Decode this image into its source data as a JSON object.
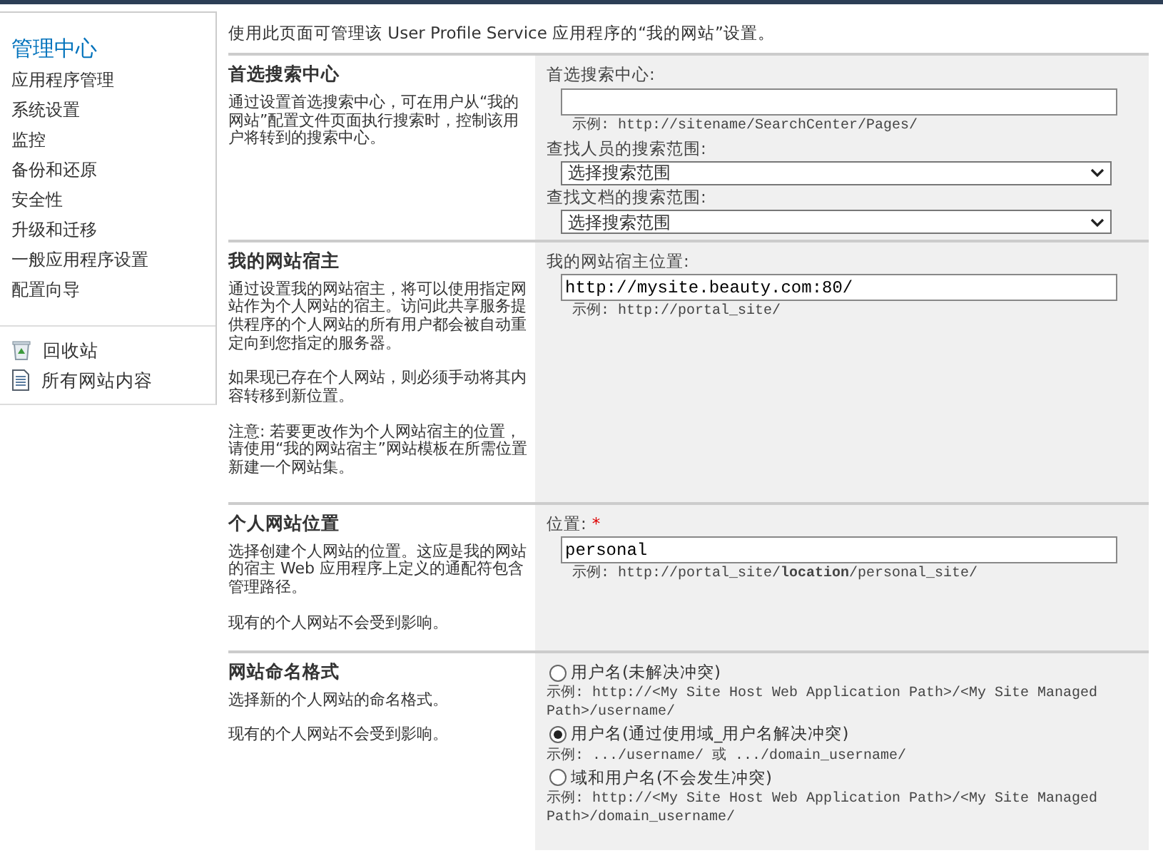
{
  "sidebar": {
    "title": "管理中心",
    "items": [
      "应用程序管理",
      "系统设置",
      "监控",
      "备份和还原",
      "安全性",
      "升级和迁移",
      "一般应用程序设置",
      "配置向导"
    ],
    "links": [
      {
        "label": "回收站",
        "kind": "recycle"
      },
      {
        "label": "所有网站内容",
        "kind": "content"
      }
    ]
  },
  "intro": "使用此页面可管理该 User Profile Service 应用程序的“我的网站”设置。",
  "sections": [
    {
      "title": "首选搜索中心",
      "descriptions": [
        "通过设置首选搜索中心，可在用户从“我的网站”配置文件页面执行搜索时，控制该用户将转到的搜索中心。"
      ],
      "fields": [
        {
          "kind": "text",
          "label": "首选搜索中心:",
          "example": "示例: http://sitename/SearchCenter/Pages/"
        },
        {
          "kind": "select",
          "label": "查找人员的搜索范围:",
          "value": "选择搜索范围"
        },
        {
          "kind": "select",
          "label": "查找文档的搜索范围:",
          "value": "选择搜索范围"
        }
      ]
    },
    {
      "title": "我的网站宿主",
      "descriptions": [
        "通过设置我的网站宿主，将可以使用指定网站作为个人网站的宿主。访问此共享服务提供程序的个人网站的所有用户都会被自动重定向到您指定的服务器。",
        "如果现已存在个人网站，则必须手动将其内容转移到新位置。",
        "注意: 若要更改作为个人网站宿主的位置，请使用“我的网站宿主”网站模板在所需位置新建一个网站集。"
      ],
      "fields": [
        {
          "kind": "text",
          "label": "我的网站宿主位置:",
          "value": "http://mysite.beauty.com:80/",
          "example": "示例: http://portal_site/"
        }
      ]
    },
    {
      "title": "个人网站位置",
      "descriptions": [
        "选择创建个人网站的位置。这应是我的网站的宿主 Web 应用程序上定义的通配符包含管理路径。",
        "现有的个人网站不会受到影响。"
      ],
      "fields": [
        {
          "kind": "text",
          "label": "位置:",
          "required_mark": "*",
          "value": "personal",
          "example": "示例: http://portal_site/**location**/personal_site/"
        }
      ]
    },
    {
      "title": "网站命名格式",
      "descriptions": [
        "选择新的个人网站的命名格式。",
        "现有的个人网站不会受到影响。"
      ],
      "fields": [
        {
          "kind": "radio",
          "label": "用户名(未解决冲突)",
          "selected": false,
          "example": "示例: http://<My Site Host Web Application Path>/<My Site Managed Path>/username/"
        },
        {
          "kind": "radio",
          "label": "用户名(通过使用域_用户名解决冲突)",
          "selected": true,
          "example": "示例: .../username/ 或 .../domain_username/"
        },
        {
          "kind": "radio",
          "label": "域和用户名(不会发生冲突)",
          "selected": false,
          "example": "示例: http://<My Site Host Web Application Path>/<My Site Managed Path>/domain_username/"
        }
      ]
    }
  ]
}
